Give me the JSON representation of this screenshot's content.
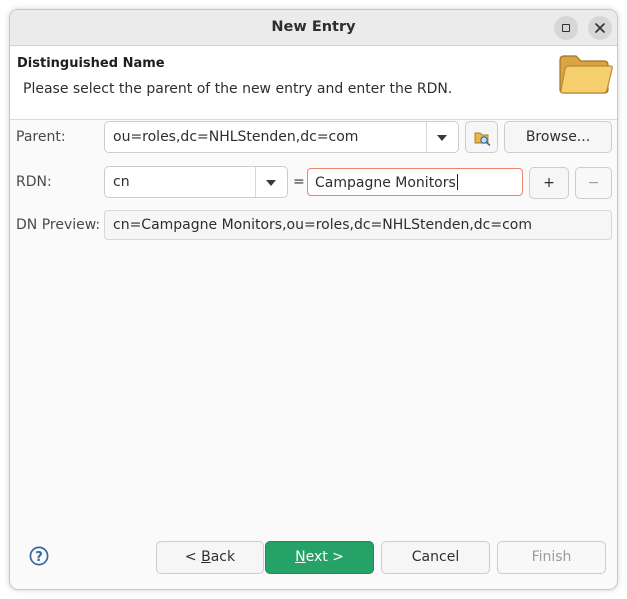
{
  "window": {
    "title": "New Entry"
  },
  "header": {
    "title": "Distinguished Name",
    "description": "Please select the parent of the new entry and enter the RDN."
  },
  "form": {
    "parent": {
      "label": "Parent:",
      "value": "ou=roles,dc=NHLStenden,dc=com",
      "browse_label": "Browse..."
    },
    "rdn": {
      "label": "RDN:",
      "attribute": "cn",
      "equals": "=",
      "value": "Campagne Monitors",
      "add_label": "+",
      "remove_label": "−"
    },
    "dn_preview": {
      "label": "DN Preview:",
      "value": "cn=Campagne Monitors,ou=roles,dc=NHLStenden,dc=com"
    }
  },
  "footer": {
    "back_prefix": "< ",
    "back_mnemonic": "B",
    "back_rest": "ack",
    "next_mnemonic": "N",
    "next_rest": "ext >",
    "cancel_label": "Cancel",
    "finish_label": "Finish"
  },
  "colors": {
    "accent_green": "#26a269",
    "focus_border": "#e9876b",
    "help_blue": "#3465a4"
  },
  "icons": {
    "folder": "folder-icon",
    "parent_picker": "folder-search-icon",
    "help": "help-icon",
    "maximize": "maximize-icon",
    "close": "close-icon"
  }
}
